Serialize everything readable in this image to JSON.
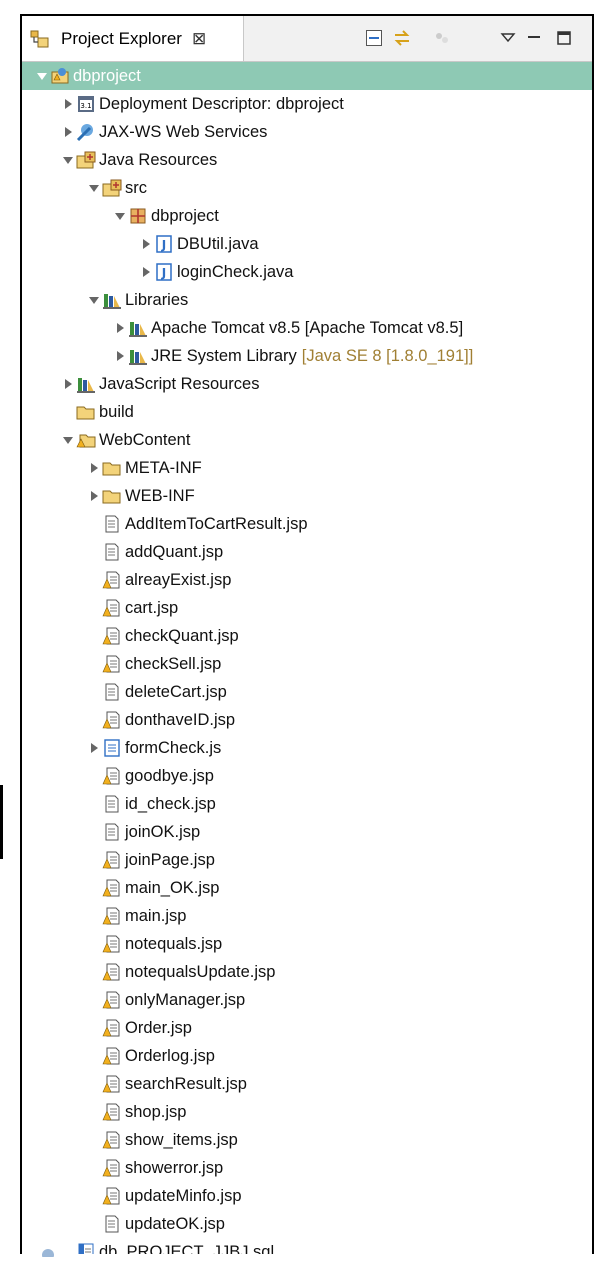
{
  "explorer": {
    "tab_title": "Project Explorer",
    "tab_close_symbol": "⊠",
    "toolbar": {
      "collapse_all": "collapse-all-icon",
      "link_with_editor": "link-with-editor-icon",
      "focus": "focus-icon",
      "view_menu": "view-menu-icon",
      "minimize": "minimize-icon",
      "maximize": "maximize-icon"
    }
  },
  "tree": {
    "rows": [
      {
        "label": "dbproject",
        "depth": 0,
        "twisty": "open",
        "icon": "web-project-icon",
        "selected": true
      },
      {
        "label": "Deployment Descriptor: dbproject",
        "depth": 1,
        "twisty": "closed",
        "icon": "deployment-descriptor-icon"
      },
      {
        "label": "JAX-WS Web Services",
        "depth": 1,
        "twisty": "closed",
        "icon": "web-services-icon"
      },
      {
        "label": "Java Resources",
        "depth": 1,
        "twisty": "open",
        "icon": "java-resources-icon"
      },
      {
        "label": "src",
        "depth": 2,
        "twisty": "open",
        "icon": "source-folder-icon"
      },
      {
        "label": "dbproject",
        "depth": 3,
        "twisty": "open",
        "icon": "package-icon"
      },
      {
        "label": "DBUtil.java",
        "depth": 4,
        "twisty": "closed",
        "icon": "java-file-icon"
      },
      {
        "label": "loginCheck.java",
        "depth": 4,
        "twisty": "closed",
        "icon": "java-file-icon"
      },
      {
        "label": "Libraries",
        "depth": 2,
        "twisty": "open",
        "icon": "library-icon"
      },
      {
        "label": "Apache Tomcat v8.5 [Apache Tomcat v8.5]",
        "depth": 3,
        "twisty": "closed",
        "icon": "library-icon"
      },
      {
        "label": "JRE System Library",
        "decoration": "[Java SE 8 [1.8.0_191]]",
        "depth": 3,
        "twisty": "closed",
        "icon": "library-icon"
      },
      {
        "label": "JavaScript Resources",
        "depth": 1,
        "twisty": "closed",
        "icon": "library-icon"
      },
      {
        "label": "build",
        "depth": 1,
        "twisty": "none",
        "icon": "folder-icon"
      },
      {
        "label": "WebContent",
        "depth": 1,
        "twisty": "open",
        "icon": "folder-warning-icon"
      },
      {
        "label": "META-INF",
        "depth": 2,
        "twisty": "closed",
        "icon": "folder-icon"
      },
      {
        "label": "WEB-INF",
        "depth": 2,
        "twisty": "closed",
        "icon": "folder-icon"
      },
      {
        "label": "AddItemToCartResult.jsp",
        "depth": 2,
        "twisty": "none",
        "icon": "jsp-file-icon"
      },
      {
        "label": "addQuant.jsp",
        "depth": 2,
        "twisty": "none",
        "icon": "jsp-file-icon"
      },
      {
        "label": "alreayExist.jsp",
        "depth": 2,
        "twisty": "none",
        "icon": "jsp-file-warning-icon"
      },
      {
        "label": "cart.jsp",
        "depth": 2,
        "twisty": "none",
        "icon": "jsp-file-warning-icon"
      },
      {
        "label": "checkQuant.jsp",
        "depth": 2,
        "twisty": "none",
        "icon": "jsp-file-warning-icon"
      },
      {
        "label": "checkSell.jsp",
        "depth": 2,
        "twisty": "none",
        "icon": "jsp-file-warning-icon"
      },
      {
        "label": "deleteCart.jsp",
        "depth": 2,
        "twisty": "none",
        "icon": "jsp-file-icon"
      },
      {
        "label": "donthaveID.jsp",
        "depth": 2,
        "twisty": "none",
        "icon": "jsp-file-warning-icon"
      },
      {
        "label": "formCheck.js",
        "depth": 2,
        "twisty": "closed",
        "icon": "js-file-icon"
      },
      {
        "label": "goodbye.jsp",
        "depth": 2,
        "twisty": "none",
        "icon": "jsp-file-warning-icon"
      },
      {
        "label": "id_check.jsp",
        "depth": 2,
        "twisty": "none",
        "icon": "jsp-file-icon"
      },
      {
        "label": "joinOK.jsp",
        "depth": 2,
        "twisty": "none",
        "icon": "jsp-file-icon"
      },
      {
        "label": "joinPage.jsp",
        "depth": 2,
        "twisty": "none",
        "icon": "jsp-file-warning-icon"
      },
      {
        "label": "main_OK.jsp",
        "depth": 2,
        "twisty": "none",
        "icon": "jsp-file-warning-icon"
      },
      {
        "label": "main.jsp",
        "depth": 2,
        "twisty": "none",
        "icon": "jsp-file-warning-icon"
      },
      {
        "label": "notequals.jsp",
        "depth": 2,
        "twisty": "none",
        "icon": "jsp-file-warning-icon"
      },
      {
        "label": "notequalsUpdate.jsp",
        "depth": 2,
        "twisty": "none",
        "icon": "jsp-file-warning-icon"
      },
      {
        "label": "onlyManager.jsp",
        "depth": 2,
        "twisty": "none",
        "icon": "jsp-file-warning-icon"
      },
      {
        "label": "Order.jsp",
        "depth": 2,
        "twisty": "none",
        "icon": "jsp-file-warning-icon"
      },
      {
        "label": "Orderlog.jsp",
        "depth": 2,
        "twisty": "none",
        "icon": "jsp-file-warning-icon"
      },
      {
        "label": "searchResult.jsp",
        "depth": 2,
        "twisty": "none",
        "icon": "jsp-file-warning-icon"
      },
      {
        "label": "shop.jsp",
        "depth": 2,
        "twisty": "none",
        "icon": "jsp-file-warning-icon"
      },
      {
        "label": "show_items.jsp",
        "depth": 2,
        "twisty": "none",
        "icon": "jsp-file-warning-icon"
      },
      {
        "label": "showerror.jsp",
        "depth": 2,
        "twisty": "none",
        "icon": "jsp-file-warning-icon"
      },
      {
        "label": "updateMinfo.jsp",
        "depth": 2,
        "twisty": "none",
        "icon": "jsp-file-warning-icon"
      },
      {
        "label": "updateOK.jsp",
        "depth": 2,
        "twisty": "none",
        "icon": "jsp-file-icon"
      },
      {
        "label": "db_PROJECT_JJBJ.sql",
        "depth": 1,
        "twisty": "none",
        "icon": "sql-file-icon"
      }
    ]
  },
  "colors": {
    "selection": "#8ec9b4",
    "decoration": "#a07f33",
    "warning": "#f2b01e",
    "java_blue": "#2f6fc5"
  }
}
